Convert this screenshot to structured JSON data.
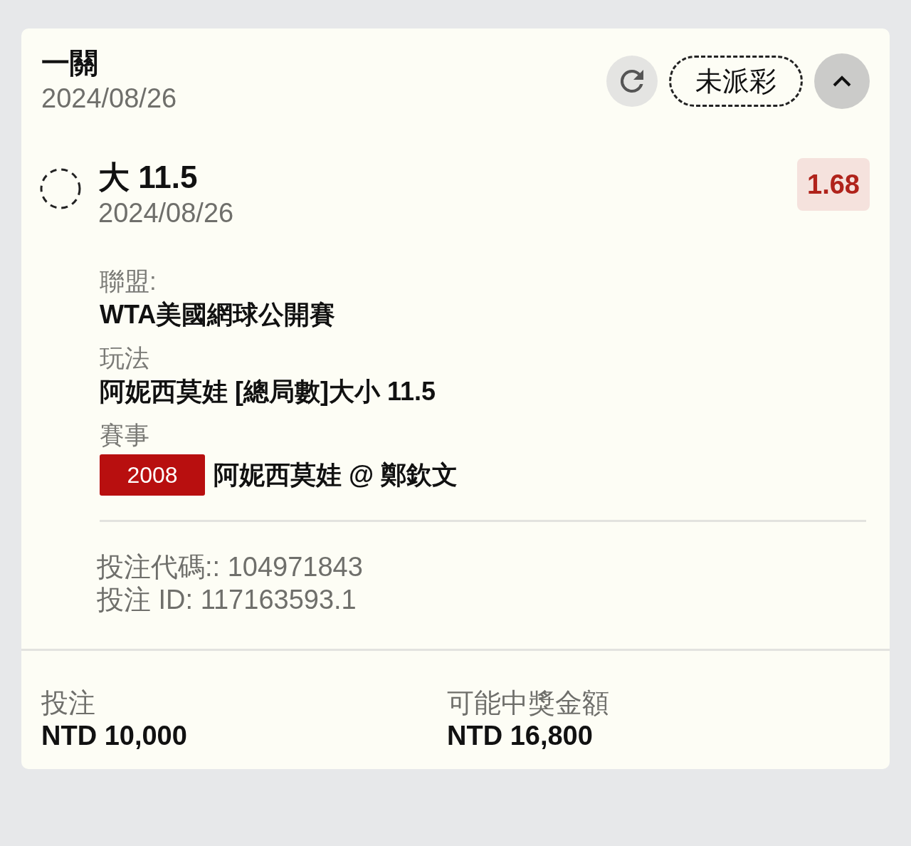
{
  "header": {
    "bet_type": "一關",
    "date": "2024/08/26",
    "status": "未派彩",
    "expanded": true
  },
  "selection": {
    "name": "大 11.5",
    "date": "2024/08/26",
    "odds": "1.68"
  },
  "details": [
    {
      "kind": "text",
      "label": "聯盟:",
      "value": "WTA美國網球公開賽"
    },
    {
      "kind": "text",
      "label": "玩法",
      "value": "阿妮西莫娃 [總局數]大小 11.5"
    },
    {
      "kind": "event",
      "label": "賽事",
      "code": "2008",
      "value": "阿妮西莫娃 @ 鄭欽文"
    }
  ],
  "references": [
    "投注代碼:: 104971843",
    "投注 ID: 117163593.1"
  ],
  "footer": {
    "stake_label": "投注",
    "stake": "NTD 10,000",
    "payout_label": "可能中獎金額",
    "payout": "NTD 16,800"
  }
}
